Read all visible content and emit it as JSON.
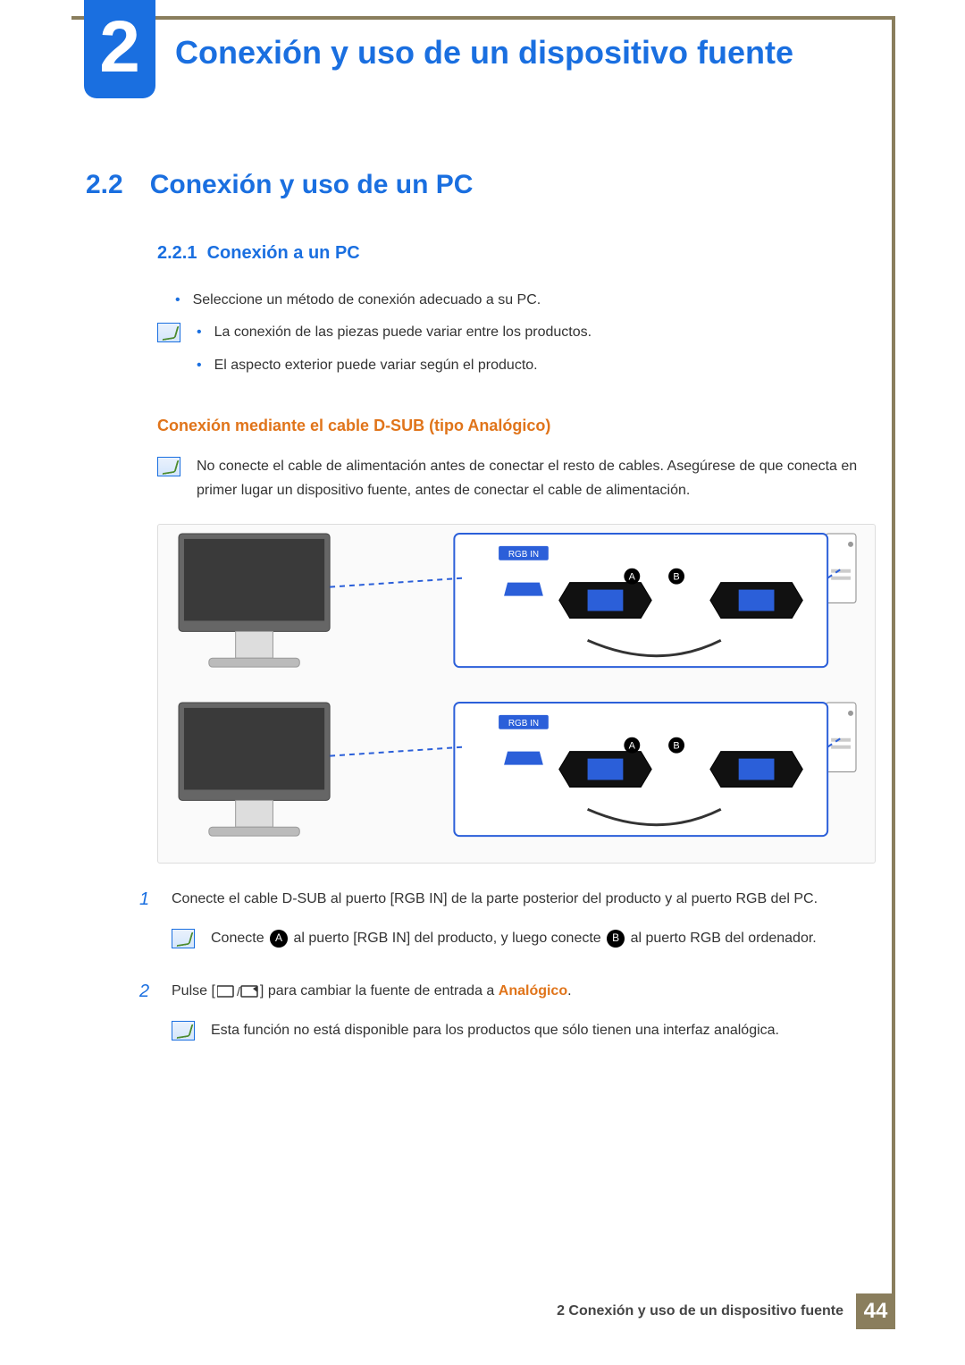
{
  "chapter": {
    "number": "2",
    "title": "Conexión y uso de un dispositivo fuente"
  },
  "section": {
    "number": "2.2",
    "title": "Conexión y uso de un PC"
  },
  "subsection": {
    "number": "2.2.1",
    "title": "Conexión a un PC"
  },
  "bullets": {
    "select_method": "Seleccione un método de conexión adecuado a su PC."
  },
  "note1": {
    "line1": "La conexión de las piezas puede variar entre los productos.",
    "line2": "El aspecto exterior puede variar según el producto."
  },
  "h4": "Conexión mediante el cable D-SUB (tipo Analógico)",
  "note2": "No conecte el cable de alimentación antes de conectar el resto de cables. Asegúrese de que conecta en primer lugar un dispositivo fuente, antes de conectar el cable de alimentación.",
  "diagram": {
    "port_label": "RGB IN",
    "a": "A",
    "b": "B"
  },
  "steps": {
    "step1": "Conecte el cable D-SUB al puerto [RGB IN] de la parte posterior del producto y al puerto RGB del PC.",
    "step1_note_a": "Conecte ",
    "step1_note_mid": " al puerto [RGB IN] del producto, y luego conecte ",
    "step1_note_b": " al puerto RGB del ordenador.",
    "step2_a": "Pulse [",
    "step2_b": "] para cambiar la fuente de entrada a ",
    "step2_kw": "Analógico",
    "step2_c": ".",
    "step2_note": "Esta función no está disponible para los productos que sólo tienen una interfaz analógica."
  },
  "nums": {
    "one": "1",
    "two": "2"
  },
  "letters": {
    "a": "A",
    "b": "B"
  },
  "footer": {
    "text": "2 Conexión y uso de un dispositivo fuente",
    "page": "44"
  }
}
